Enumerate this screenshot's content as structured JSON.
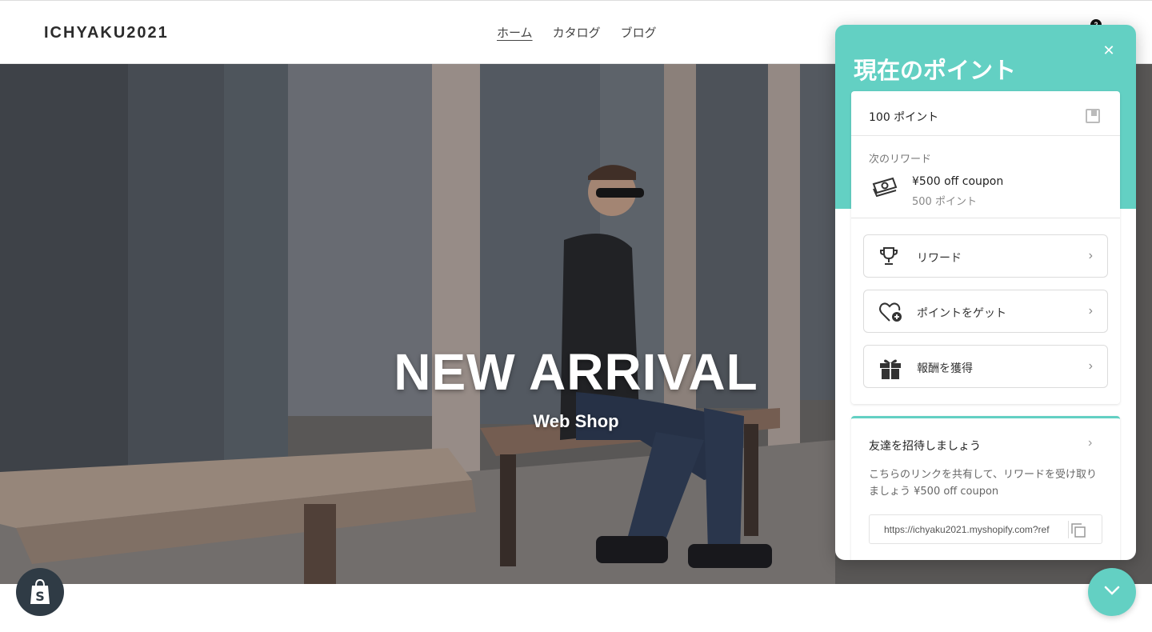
{
  "header": {
    "logo": "ICHYAKU2021",
    "nav": [
      {
        "label": "ホーム",
        "active": true
      },
      {
        "label": "カタログ",
        "active": false
      },
      {
        "label": "ブログ",
        "active": false
      }
    ],
    "cart_count": "2"
  },
  "hero": {
    "title": "NEW ARRIVAL",
    "subtitle": "Web Shop"
  },
  "panel": {
    "title": "現在のポイント",
    "close_icon": "close-icon",
    "points": "100 ポイント",
    "next_reward_label": "次のリワード",
    "next_reward": {
      "name": "¥500 off coupon",
      "cost": "500 ポイント",
      "icon": "money-icon"
    },
    "menu": [
      {
        "label": "リワード",
        "icon": "trophy-icon"
      },
      {
        "label": "ポイントをゲット",
        "icon": "heart-plus-icon"
      },
      {
        "label": "報酬を獲得",
        "icon": "gift-icon"
      }
    ],
    "referral": {
      "title": "友達を招待しましょう",
      "description": "こちらのリンクを共有して、リワードを受け取りましょう ¥500 off coupon",
      "link": "https://ichyaku2021.myshopify.com?ref"
    }
  },
  "colors": {
    "accent": "#63d0c3",
    "badge": "#2f3b45"
  }
}
